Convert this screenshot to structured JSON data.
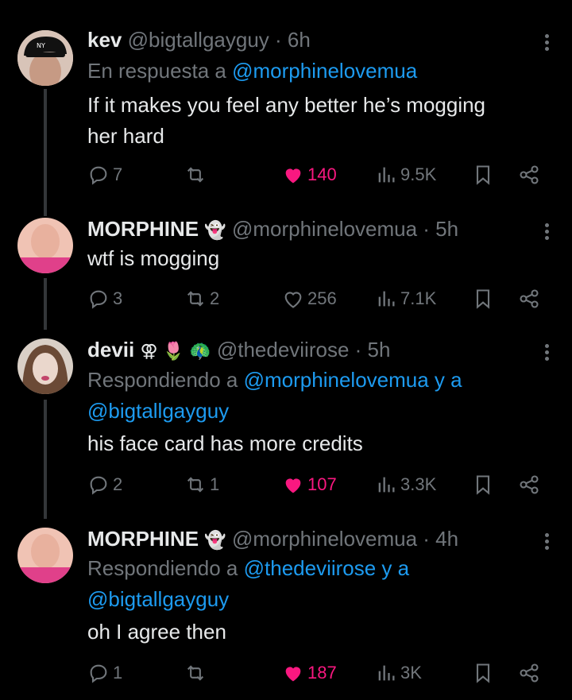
{
  "tweets": [
    {
      "name": "kev",
      "handle": "@bigtallgayguy",
      "time": "· 6h",
      "reply_prefix": "En respuesta a",
      "reply_targets": "@morphinelovemua",
      "reply_targets_2": "",
      "text_1": "If it makes you feel any better he’s mogging",
      "text_2": "her hard",
      "replies": "7",
      "retweets": "",
      "likes": "140",
      "liked": true,
      "views": "9.5K"
    },
    {
      "name": "MORPHINE",
      "badge": "👻",
      "handle": "@morphinelovemua",
      "time": "· 5h",
      "text_1": "wtf is mogging",
      "replies": "3",
      "retweets": "2",
      "likes": "256",
      "liked": false,
      "views": "7.1K"
    },
    {
      "name": "devii",
      "badge": "⚢ 🌷 🦚",
      "handle": "@thedeviirose",
      "time": "· 5h",
      "reply_prefix": "Respondiendo a",
      "reply_targets": "@morphinelovemua y a",
      "reply_targets_2": "@bigtallgayguy",
      "text_1": "his face card has more credits",
      "replies": "2",
      "retweets": "1",
      "likes": "107",
      "liked": true,
      "views": "3.3K"
    },
    {
      "name": "MORPHINE",
      "badge": "👻",
      "handle": "@morphinelovemua",
      "time": "· 4h",
      "reply_prefix": "Respondiendo a",
      "reply_targets": "@thedeviirose y a",
      "reply_targets_2": "@bigtallgayguy",
      "text_1": "oh I agree then",
      "replies": "1",
      "retweets": "",
      "likes": "187",
      "liked": true,
      "views": "3K"
    }
  ],
  "colors": {
    "background": "#000000",
    "text": "#e7e9ea",
    "muted": "#71767b",
    "link": "#1d9bf0",
    "like": "#f91880"
  },
  "icons": [
    "reply-icon",
    "retweet-icon",
    "heart-icon",
    "views-icon",
    "bookmark-icon",
    "share-icon",
    "more-icon"
  ]
}
